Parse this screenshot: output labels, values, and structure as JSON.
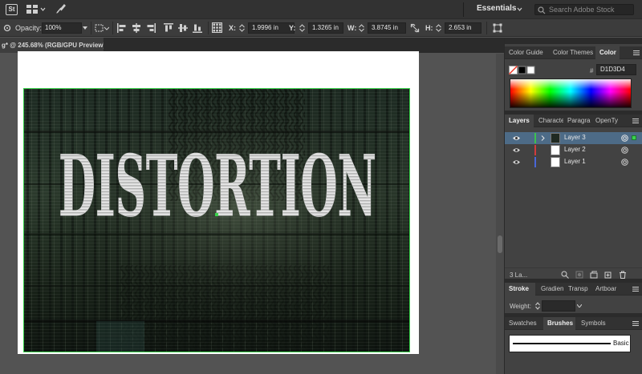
{
  "app": {
    "logo_text": "St",
    "workspace": "Essentials",
    "search_placeholder": "Search Adobe Stock"
  },
  "control_bar": {
    "opacity_label": "Opacity:",
    "opacity_value": "100%",
    "x_label": "X:",
    "x_value": "1.9996 in",
    "y_label": "Y:",
    "y_value": "1.3265 in",
    "w_label": "W:",
    "w_value": "3.8745 in",
    "h_label": "H:",
    "h_value": "2.653 in"
  },
  "document": {
    "tab_title": "g* @ 245.68% (RGB/GPU Preview)",
    "artwork_text": "DISTORTION"
  },
  "color_panel": {
    "tabs": [
      "Color Guide",
      "Color Themes",
      "Color"
    ],
    "active_tab": "Color",
    "hash": "#",
    "hex_value": "D1D3D4"
  },
  "layers_panel": {
    "tabs": [
      "Layers",
      "Characte",
      "Paragra",
      "OpenTy"
    ],
    "active_tab": "Layers",
    "layers": [
      {
        "name": "Layer 3",
        "color": "#3cc24e",
        "selected": true
      },
      {
        "name": "Layer 2",
        "color": "#d23b3b",
        "selected": false
      },
      {
        "name": "Layer 1",
        "color": "#4a67d8",
        "selected": false
      }
    ],
    "count": "3 La..."
  },
  "stroke_panel": {
    "tabs": [
      "Stroke",
      "Gradien",
      "Transp",
      "Artboar"
    ],
    "active_tab": "Stroke",
    "weight_label": "Weight:"
  },
  "brushes_panel": {
    "tabs": [
      "Swatches",
      "Brushes",
      "Symbols"
    ],
    "active_tab": "Brushes",
    "brush_name": "Basic"
  },
  "colors": {
    "accent_green": "#39d24a",
    "selection_blue": "#4d6b87",
    "app_bg": "#535353"
  }
}
